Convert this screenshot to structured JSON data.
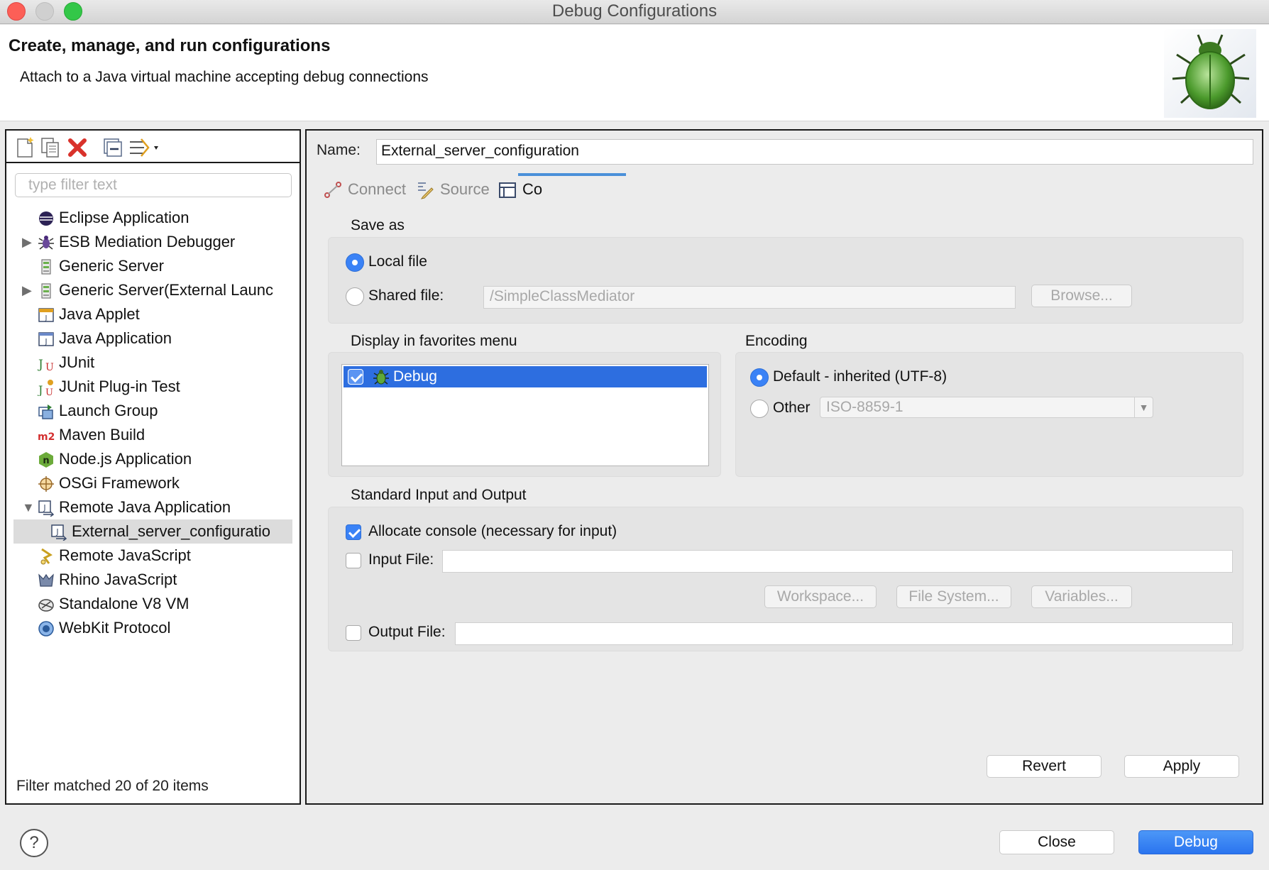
{
  "window": {
    "title": "Debug Configurations"
  },
  "header": {
    "title": "Create, manage, and run configurations",
    "subtitle": "Attach to a Java virtual machine accepting debug connections",
    "logo_icon": "bug-logo-icon"
  },
  "left": {
    "toolbar": [
      "new-config-icon",
      "duplicate-icon",
      "delete-icon",
      "collapse-all-icon",
      "filter-icon"
    ],
    "filter_placeholder": "type filter text",
    "tree": [
      {
        "label": "Eclipse Application",
        "icon": "eclipse-icon",
        "expandable": false,
        "expanded": false,
        "level": 0
      },
      {
        "label": "ESB Mediation Debugger",
        "icon": "bug-icon",
        "expandable": true,
        "expanded": false,
        "level": 0
      },
      {
        "label": "Generic Server",
        "icon": "server-icon",
        "expandable": false,
        "expanded": false,
        "level": 0
      },
      {
        "label": "Generic Server(External Launc",
        "icon": "server-icon",
        "expandable": true,
        "expanded": false,
        "level": 0
      },
      {
        "label": "Java Applet",
        "icon": "applet-icon",
        "expandable": false,
        "expanded": false,
        "level": 0
      },
      {
        "label": "Java Application",
        "icon": "java-app-icon",
        "expandable": false,
        "expanded": false,
        "level": 0
      },
      {
        "label": "JUnit",
        "icon": "junit-icon",
        "expandable": false,
        "expanded": false,
        "level": 0
      },
      {
        "label": "JUnit Plug-in Test",
        "icon": "junit-plugin-icon",
        "expandable": false,
        "expanded": false,
        "level": 0
      },
      {
        "label": "Launch Group",
        "icon": "launch-group-icon",
        "expandable": false,
        "expanded": false,
        "level": 0
      },
      {
        "label": "Maven Build",
        "icon": "maven-icon",
        "expandable": false,
        "expanded": false,
        "level": 0
      },
      {
        "label": "Node.js Application",
        "icon": "nodejs-icon",
        "expandable": false,
        "expanded": false,
        "level": 0
      },
      {
        "label": "OSGi Framework",
        "icon": "osgi-icon",
        "expandable": false,
        "expanded": false,
        "level": 0
      },
      {
        "label": "Remote Java Application",
        "icon": "remote-java-icon",
        "expandable": true,
        "expanded": true,
        "level": 0
      },
      {
        "label": "External_server_configuratio",
        "icon": "remote-java-icon",
        "expandable": false,
        "expanded": false,
        "level": 1,
        "selected": true
      },
      {
        "label": "Remote JavaScript",
        "icon": "remote-js-icon",
        "expandable": false,
        "expanded": false,
        "level": 0
      },
      {
        "label": "Rhino JavaScript",
        "icon": "rhino-icon",
        "expandable": false,
        "expanded": false,
        "level": 0
      },
      {
        "label": "Standalone V8 VM",
        "icon": "v8-icon",
        "expandable": false,
        "expanded": false,
        "level": 0
      },
      {
        "label": "WebKit Protocol",
        "icon": "webkit-icon",
        "expandable": false,
        "expanded": false,
        "level": 0
      }
    ],
    "status": "Filter matched 20 of 20 items"
  },
  "right": {
    "name_label": "Name:",
    "name_value": "External_server_configuration",
    "tabs": [
      {
        "label": "Connect",
        "icon": "connect-icon",
        "active": false
      },
      {
        "label": "Source",
        "icon": "source-icon",
        "active": false
      },
      {
        "label": "Co",
        "icon": "common-icon",
        "active": true
      }
    ],
    "save_as": {
      "label": "Save as",
      "local_label": "Local file",
      "shared_label": "Shared file:",
      "shared_value": "/SimpleClassMediator",
      "browse_label": "Browse...",
      "selected": "local"
    },
    "favorites": {
      "label": "Display in favorites menu",
      "items": [
        {
          "label": "Debug",
          "checked": true,
          "icon": "debug-bug-icon"
        }
      ]
    },
    "encoding": {
      "label": "Encoding",
      "default_label": "Default - inherited (UTF-8)",
      "other_label": "Other",
      "other_value": "ISO-8859-1",
      "selected": "default"
    },
    "std_io": {
      "label": "Standard Input and Output",
      "allocate_label": "Allocate console (necessary for input)",
      "allocate_checked": true,
      "input_label": "Input File:",
      "input_checked": false,
      "input_value": "",
      "workspace_label": "Workspace...",
      "filesystem_label": "File System...",
      "variables_label": "Variables...",
      "output_label": "Output File:",
      "output_checked": false,
      "output_value": ""
    },
    "revert_label": "Revert",
    "apply_label": "Apply"
  },
  "footer": {
    "help_icon": "help-icon",
    "help_glyph": "?",
    "close_label": "Close",
    "debug_label": "Debug"
  },
  "colors": {
    "accent": "#3a82f6",
    "selection": "#2d6ee0",
    "tab_underline": "#4a90d9"
  }
}
